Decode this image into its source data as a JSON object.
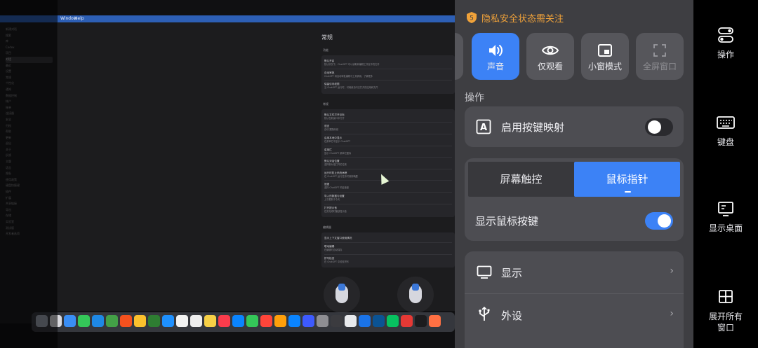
{
  "mac": {
    "menu": [
      "Window",
      "Help"
    ],
    "settings": {
      "title": "常规",
      "sections": [
        {
          "label": "功能",
          "rows": [
            {
              "title": "默认开启",
              "sub": "默认情况下，ChatGPT 可以读取和编辑工作区中的文件"
            },
            {
              "title": "自动审批",
              "sub": "ChatGPT 将自动审批编辑与工具调用，了解更多"
            },
            {
              "title": "保留访问权限",
              "sub": "当 ChatGPT 运行时，可继续访问已打开的应用和文件"
            }
          ]
        },
        {
          "label": "常规",
          "rows": [
            {
              "title": "默认文件打开目标",
              "sub": "默认在新窗口中打开"
            },
            {
              "title": "语言",
              "sub": "自动 跟随系统"
            },
            {
              "title": "启用本地中显示",
              "sub": "在菜单栏中显示 ChatGPT"
            },
            {
              "title": "菜单栏",
              "sub": "显示 ChatGPT 菜单栏图标"
            },
            {
              "title": "默认对话位置",
              "sub": "选择新对话打开的位置"
            },
            {
              "title": "运行时防止系统休眠",
              "sub": "在 ChatGPT 运行任务时保持唤醒"
            },
            {
              "title": "速度",
              "sub": "选择 ChatGPT 响应速度"
            },
            {
              "title": "导入的数据与设置",
              "sub": "上次更新于今天"
            },
            {
              "title": "打开提示音",
              "sub": "任务完成时播放提示音"
            }
          ]
        },
        {
          "label": "编辑器",
          "rows": [
            {
              "title": "显示上下文窗口使用情况",
              "sub": ""
            },
            {
              "title": "联动编辑",
              "sub": "在编辑时自动保存"
            },
            {
              "title": "拼写检查",
              "sub": "在 ChatGPT 中检查拼写"
            }
          ]
        }
      ]
    },
    "sidebar": [
      "新建对话",
      "搜索",
      "库",
      "Codex",
      "项目",
      "对话",
      "最近",
      "设置",
      "常规",
      "个性化",
      "通知",
      "数据控制",
      "帐户",
      "账单",
      "连接器",
      "安全",
      "归档",
      "帮助",
      "更新",
      "退出",
      "关于",
      "反馈",
      "主题",
      "语言",
      "隐私",
      "使用政策",
      "键盘快捷键",
      "插件",
      "扩展",
      "共享链接",
      "导出",
      "存储",
      "实验室",
      "测试版",
      "开发者选项"
    ]
  },
  "panel": {
    "privacy_text": "隐私安全状态需关注",
    "modes": [
      {
        "label": "声音",
        "icon": "speaker-icon",
        "active": true
      },
      {
        "label": "仅观看",
        "icon": "eye-icon",
        "active": false
      },
      {
        "label": "小窗模式",
        "icon": "pip-icon",
        "active": false
      },
      {
        "label": "全屏窗口",
        "icon": "fullscreen-icon",
        "active": false,
        "disabled": true
      }
    ],
    "section_label": "操作",
    "key_mapping": {
      "label": "启用按键映射",
      "enabled": false
    },
    "input_modes": {
      "options": [
        "屏幕触控",
        "鼠标指针"
      ],
      "selected": "鼠标指针"
    },
    "show_mouse_buttons": {
      "label": "显示鼠标按键",
      "enabled": true
    },
    "menu": [
      {
        "label": "显示",
        "icon": "display-icon"
      },
      {
        "label": "外设",
        "icon": "usb-icon"
      }
    ]
  },
  "toolbar": [
    {
      "label": "操作",
      "icon": "toggle-icon"
    },
    {
      "label": "键盘",
      "icon": "keyboard-icon"
    },
    {
      "label": "显示桌面",
      "icon": "desktop-icon"
    },
    {
      "label": "展开所有\n窗口",
      "line1": "展开所有",
      "line2": "窗口",
      "icon": "grid-icon"
    }
  ]
}
